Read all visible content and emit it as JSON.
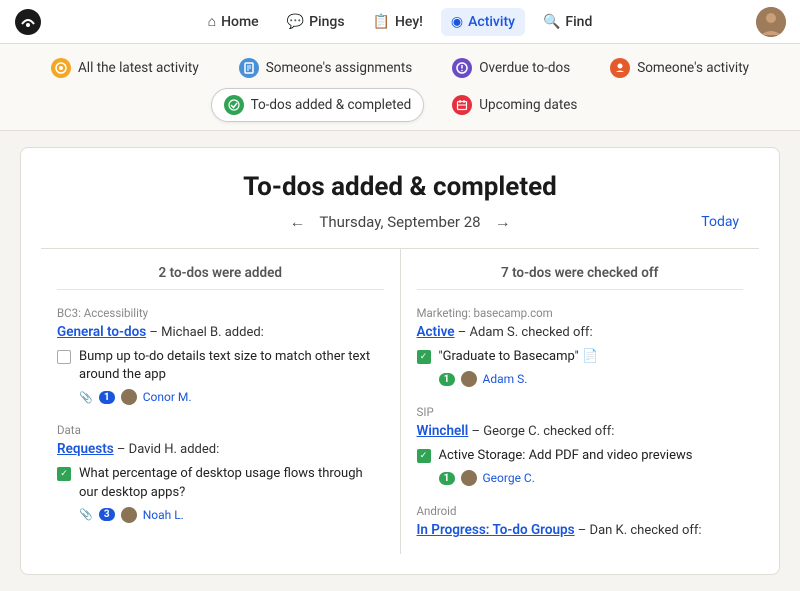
{
  "nav": {
    "items": [
      {
        "label": "Home",
        "icon": "⌂",
        "active": false
      },
      {
        "label": "Pings",
        "icon": "💬",
        "active": false
      },
      {
        "label": "Hey!",
        "icon": "📋",
        "active": false
      },
      {
        "label": "Activity",
        "icon": "◉",
        "active": true
      },
      {
        "label": "Find",
        "icon": "🔍",
        "active": false
      }
    ]
  },
  "subnav": {
    "items": [
      {
        "label": "All the latest activity",
        "color": "#f5a623",
        "active": false
      },
      {
        "label": "Someone's assignments",
        "color": "#4a90d9",
        "active": false
      },
      {
        "label": "Overdue to-dos",
        "color": "#6a4cc7",
        "active": false
      },
      {
        "label": "Someone's activity",
        "color": "#e55a2b",
        "active": false
      },
      {
        "label": "To-dos added & completed",
        "color": "#31a354",
        "active": true
      },
      {
        "label": "Upcoming dates",
        "color": "#e5303e",
        "active": false
      }
    ]
  },
  "page": {
    "title": "To-dos added & completed",
    "date": "Thursday, September 28",
    "today_label": "Today",
    "left_col_header": "2 to-dos were added",
    "right_col_header": "7 to-dos were checked off"
  },
  "left_col": {
    "sections": [
      {
        "project": "BC3: Accessibility",
        "list_link": "General to-dos",
        "added_by": "– Michael B. added:",
        "todos": [
          {
            "checked": false,
            "text": "Bump up to-do details text size to match other text around the app"
          }
        ],
        "meta": {
          "icon": "📎",
          "badge": "1",
          "person": "Conor M."
        }
      },
      {
        "project": "Data",
        "list_link": "Requests",
        "added_by": "– David H. added:",
        "todos": [
          {
            "checked": true,
            "text": "What percentage of desktop usage flows through our desktop apps?"
          }
        ],
        "meta": {
          "icon": "📎",
          "badge": "3",
          "person": "Noah L."
        }
      }
    ]
  },
  "right_col": {
    "sections": [
      {
        "project": "Marketing: basecamp.com",
        "list_link": "Active",
        "checked_by": "– Adam S. checked off:",
        "todos": [
          {
            "checked": true,
            "text": "\"Graduate to Basecamp\""
          }
        ],
        "meta": {
          "badge": "1",
          "person": "Adam S."
        }
      },
      {
        "project": "SIP",
        "list_link": "Winchell",
        "checked_by": "– George C. checked off:",
        "todos": [
          {
            "checked": true,
            "text": "Active Storage: Add PDF and video previews"
          }
        ],
        "meta": {
          "badge": "1",
          "person": "George C."
        }
      },
      {
        "project": "Android",
        "list_link": "In Progress: To-do Groups",
        "checked_by": "– Dan K. checked off:",
        "todos": [],
        "meta": null
      }
    ]
  }
}
